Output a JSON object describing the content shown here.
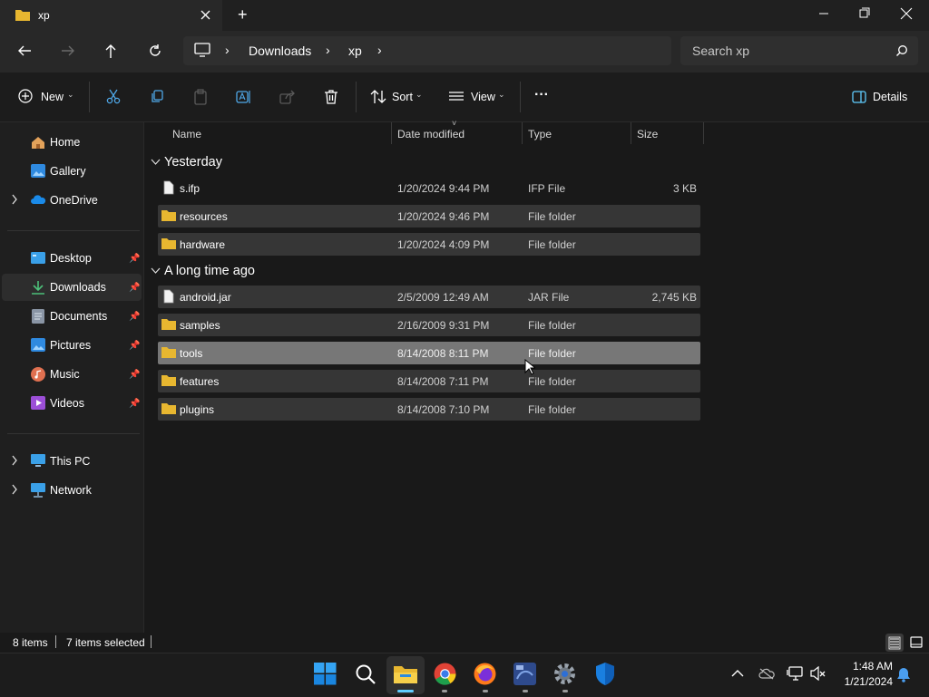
{
  "window": {
    "tab_title": "xp",
    "new_tab": "+"
  },
  "address": {
    "crumbs": [
      "Downloads",
      "xp"
    ]
  },
  "search": {
    "placeholder": "Search xp"
  },
  "toolbar": {
    "new_label": "New",
    "sort_label": "Sort",
    "view_label": "View",
    "more": "···",
    "details_label": "Details"
  },
  "sidebar": {
    "top": [
      "Home",
      "Gallery",
      "OneDrive"
    ],
    "quick": [
      "Desktop",
      "Downloads",
      "Documents",
      "Pictures",
      "Music",
      "Videos"
    ],
    "bottom": [
      "This PC",
      "Network"
    ]
  },
  "columns": {
    "name": "Name",
    "date": "Date modified",
    "type": "Type",
    "size": "Size"
  },
  "groups": {
    "yesterday": {
      "title": "Yesterday",
      "rows": [
        {
          "name": "s.ifp",
          "date": "1/20/2024 9:44 PM",
          "type": "IFP File",
          "size": "3 KB"
        },
        {
          "name": "resources",
          "date": "1/20/2024 9:46 PM",
          "type": "File folder",
          "size": ""
        },
        {
          "name": "hardware",
          "date": "1/20/2024 4:09 PM",
          "type": "File folder",
          "size": ""
        }
      ]
    },
    "old": {
      "title": "A long time ago",
      "rows": [
        {
          "name": "android.jar",
          "date": "2/5/2009 12:49 AM",
          "type": "JAR File",
          "size": "2,745 KB"
        },
        {
          "name": "samples",
          "date": "2/16/2009 9:31 PM",
          "type": "File folder",
          "size": ""
        },
        {
          "name": "tools",
          "date": "8/14/2008 8:11 PM",
          "type": "File folder",
          "size": ""
        },
        {
          "name": "features",
          "date": "8/14/2008 7:11 PM",
          "type": "File folder",
          "size": ""
        },
        {
          "name": "plugins",
          "date": "8/14/2008 7:10 PM",
          "type": "File folder",
          "size": ""
        }
      ]
    }
  },
  "status": {
    "items": "8 items",
    "selected": "7 items selected"
  },
  "clock": {
    "time": "1:48 AM",
    "date": "1/21/2024"
  },
  "colors": {
    "folder": "#e8b730",
    "accent": "#60cdff",
    "row_selected": "#363636",
    "row_hover": "#777777"
  }
}
